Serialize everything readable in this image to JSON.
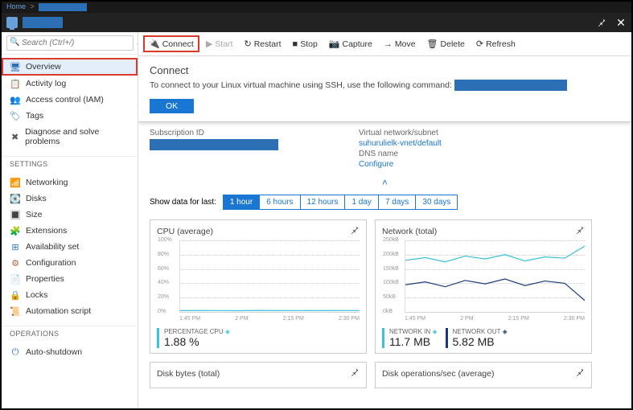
{
  "topbar": {
    "home": "Home"
  },
  "toolbar": {
    "connect": "Connect",
    "start": "Start",
    "restart": "Restart",
    "stop": "Stop",
    "capture": "Capture",
    "move": "Move",
    "delete": "Delete",
    "refresh": "Refresh"
  },
  "search": {
    "placeholder": "Search (Ctrl+/)"
  },
  "sidebar": {
    "items": [
      {
        "label": "Overview",
        "icon": "🖥",
        "color": "#2d6fb5"
      },
      {
        "label": "Activity log",
        "icon": "📋",
        "color": "#2d6fb5"
      },
      {
        "label": "Access control (IAM)",
        "icon": "👥",
        "color": "#2d6fb5"
      },
      {
        "label": "Tags",
        "icon": "🏷",
        "color": "#2d6fb5"
      },
      {
        "label": "Diagnose and solve problems",
        "icon": "✖",
        "color": "#555"
      }
    ],
    "settings_head": "SETTINGS",
    "settings": [
      {
        "label": "Networking",
        "icon": "📶",
        "color": "#2d6fb5"
      },
      {
        "label": "Disks",
        "icon": "💽",
        "color": "#2d6fb5"
      },
      {
        "label": "Size",
        "icon": "🔳",
        "color": "#2d6fb5"
      },
      {
        "label": "Extensions",
        "icon": "🧩",
        "color": "#2d6fb5"
      },
      {
        "label": "Availability set",
        "icon": "⊞",
        "color": "#2d6fb5"
      },
      {
        "label": "Configuration",
        "icon": "⚙",
        "color": "#c0603a"
      },
      {
        "label": "Properties",
        "icon": "📄",
        "color": "#2d6fb5"
      },
      {
        "label": "Locks",
        "icon": "🔒",
        "color": "#555"
      },
      {
        "label": "Automation script",
        "icon": "📜",
        "color": "#2d6fb5"
      }
    ],
    "ops_head": "OPERATIONS",
    "ops": [
      {
        "label": "Auto-shutdown",
        "icon": "⏻",
        "color": "#2d6fb5"
      }
    ]
  },
  "connect": {
    "title": "Connect",
    "text": "To connect to your Linux virtual machine using SSH, use the following command:",
    "ok": "OK"
  },
  "essentials": {
    "sub_label": "Subscription ID",
    "vnet_label": "Virtual network/subnet",
    "vnet_value": "suhurulielk-vnet/default",
    "dns_label": "DNS name",
    "dns_value": "Configure"
  },
  "timefilter": {
    "label": "Show data for last:",
    "options": [
      "1 hour",
      "6 hours",
      "12 hours",
      "1 day",
      "7 days",
      "30 days"
    ]
  },
  "charts": [
    {
      "title": "CPU (average)"
    },
    {
      "title": "Network (total)"
    },
    {
      "title": "Disk bytes (total)"
    },
    {
      "title": "Disk operations/sec (average)"
    }
  ],
  "chart_data": [
    {
      "type": "line",
      "title": "CPU (average)",
      "x_ticks": [
        "1:45 PM",
        "2 PM",
        "2:15 PM",
        "2:30 PM"
      ],
      "y_ticks": [
        "0%",
        "20%",
        "40%",
        "60%",
        "80%",
        "100%"
      ],
      "ylim": [
        0,
        100
      ],
      "series": [
        {
          "name": "PERCENTAGE CPU",
          "color": "#3cbfda",
          "values": [
            1.8,
            2.0,
            1.9,
            1.7,
            2.1,
            1.8,
            1.9,
            1.8,
            2.0,
            1.9
          ]
        }
      ],
      "metrics": [
        {
          "label": "PERCENTAGE CPU",
          "icon": "◈",
          "value": "1.88 %",
          "color": "#3cbfda"
        }
      ]
    },
    {
      "type": "line",
      "title": "Network (total)",
      "x_ticks": [
        "1:45 PM",
        "2 PM",
        "2:15 PM",
        "2:30 PM"
      ],
      "y_ticks": [
        "0kB",
        "50kB",
        "100kB",
        "150kB",
        "200kB",
        "250kB"
      ],
      "ylim": [
        0,
        250
      ],
      "series": [
        {
          "name": "NETWORK IN",
          "color": "#3cbfda",
          "values": [
            180,
            190,
            175,
            195,
            185,
            200,
            178,
            192,
            188,
            230
          ]
        },
        {
          "name": "NETWORK OUT",
          "color": "#1a3a7a",
          "values": [
            95,
            105,
            88,
            110,
            98,
            115,
            92,
            108,
            100,
            40
          ]
        }
      ],
      "metrics": [
        {
          "label": "NETWORK IN",
          "icon": "◈",
          "value": "11.7 MB",
          "color": "#3cbfda"
        },
        {
          "label": "NETWORK OUT",
          "icon": "◈",
          "value": "5.82 MB",
          "color": "#1a3a7a"
        }
      ]
    },
    {
      "type": "line",
      "title": "Disk bytes (total)",
      "series": [],
      "metrics": []
    },
    {
      "type": "line",
      "title": "Disk operations/sec (average)",
      "series": [],
      "metrics": []
    }
  ]
}
